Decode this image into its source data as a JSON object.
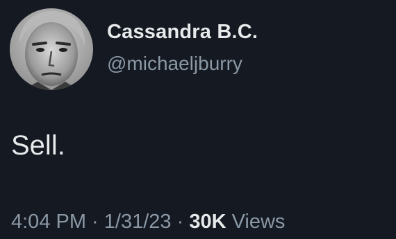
{
  "tweet": {
    "author": {
      "display_name": "Cassandra B.C.",
      "handle": "@michaeljburry",
      "avatar_icon": "profile-photo"
    },
    "text": "Sell.",
    "meta": {
      "time": "4:04 PM",
      "separator_1": " · ",
      "date": "1/31/23",
      "separator_2": " · ",
      "views_count": "30K",
      "views_label": " Views"
    }
  },
  "colors": {
    "background": "#141922",
    "primary_text": "#e7e9ea",
    "secondary_text": "#8b98a5"
  }
}
